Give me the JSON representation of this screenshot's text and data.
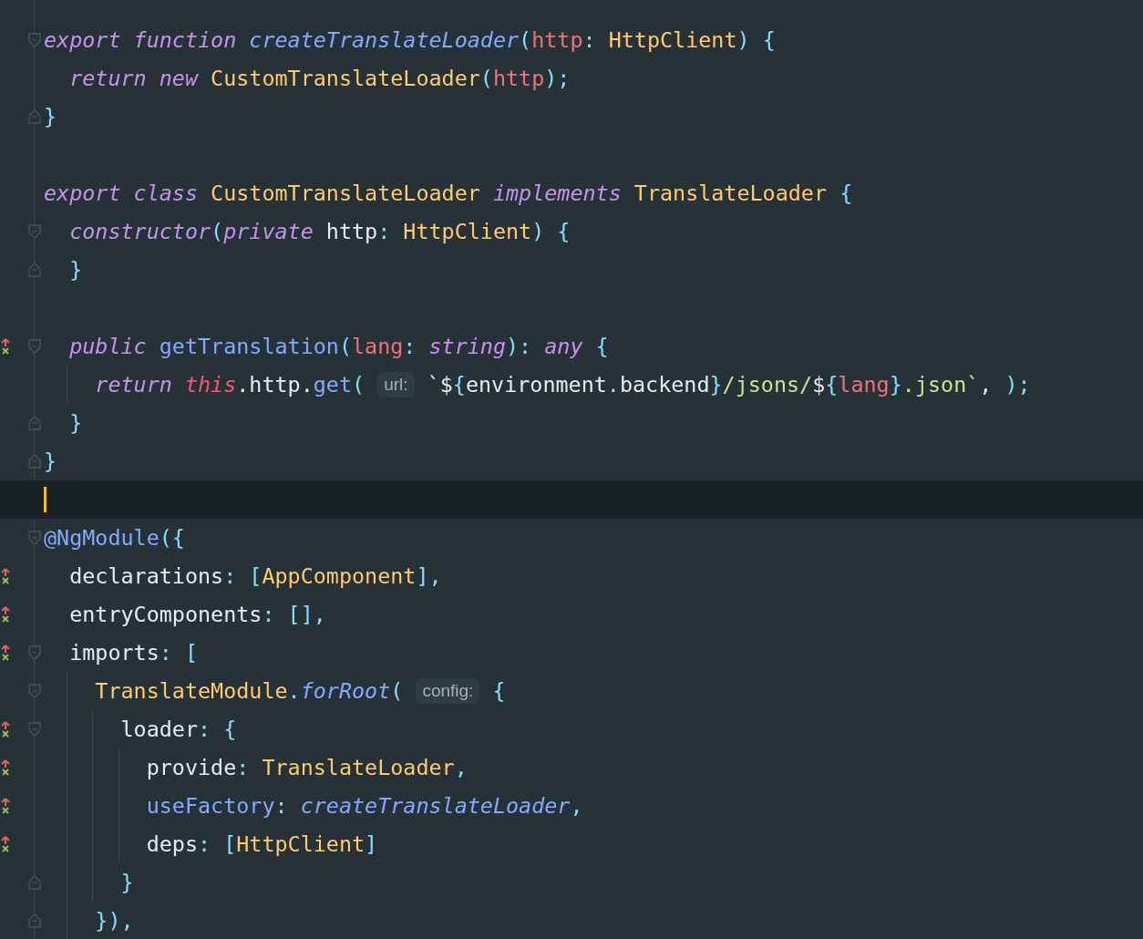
{
  "editor": {
    "lines": [
      {
        "fold_open": true,
        "fold_close": false,
        "marked": false,
        "current": false,
        "tokens": [
          {
            "kind": "kw",
            "text": "export "
          },
          {
            "kind": "kw",
            "text": "function "
          },
          {
            "kind": "fn_italic",
            "text": "createTranslateLoader"
          },
          {
            "kind": "punct",
            "text": "("
          },
          {
            "kind": "param",
            "text": "http"
          },
          {
            "kind": "punct",
            "text": ": "
          },
          {
            "kind": "type",
            "text": "HttpClient"
          },
          {
            "kind": "punct",
            "text": ") {"
          }
        ]
      },
      {
        "fold_open": false,
        "fold_close": false,
        "marked": false,
        "current": false,
        "tokens": [
          {
            "kind": "kw",
            "text": "  return "
          },
          {
            "kind": "kw",
            "text": "new "
          },
          {
            "kind": "type",
            "text": "CustomTranslateLoader"
          },
          {
            "kind": "punct",
            "text": "("
          },
          {
            "kind": "param",
            "text": "http"
          },
          {
            "kind": "punct",
            "text": ");"
          }
        ]
      },
      {
        "fold_open": false,
        "fold_close": true,
        "marked": false,
        "current": false,
        "tokens": [
          {
            "kind": "punct",
            "text": "}"
          }
        ]
      },
      {
        "fold_open": false,
        "fold_close": false,
        "marked": false,
        "current": false
      },
      {
        "fold_open": false,
        "fold_close": false,
        "marked": false,
        "current": false,
        "tokens": [
          {
            "kind": "kw",
            "text": "export "
          },
          {
            "kind": "kw",
            "text": "class "
          },
          {
            "kind": "type",
            "text": "CustomTranslateLoader "
          },
          {
            "kind": "kw",
            "text": "implements "
          },
          {
            "kind": "type",
            "text": "TranslateLoader "
          },
          {
            "kind": "punct",
            "text": "{"
          }
        ]
      },
      {
        "fold_open": true,
        "fold_close": false,
        "marked": false,
        "current": false,
        "tokens": [
          {
            "kind": "kw",
            "text": "  constructor"
          },
          {
            "kind": "punct",
            "text": "("
          },
          {
            "kind": "kw",
            "text": "private "
          },
          {
            "kind": "plain",
            "text": "http"
          },
          {
            "kind": "punct",
            "text": ": "
          },
          {
            "kind": "type",
            "text": "HttpClient"
          },
          {
            "kind": "punct",
            "text": ") {"
          }
        ]
      },
      {
        "fold_open": false,
        "fold_close": true,
        "marked": false,
        "current": false,
        "tokens": [
          {
            "kind": "punct",
            "text": "  }"
          }
        ]
      },
      {
        "fold_open": false,
        "fold_close": false,
        "marked": false,
        "current": false
      },
      {
        "fold_open": true,
        "fold_close": false,
        "marked": true,
        "current": false,
        "tokens": [
          {
            "kind": "kw",
            "text": "  public "
          },
          {
            "kind": "fn",
            "text": "getTranslation"
          },
          {
            "kind": "punct",
            "text": "("
          },
          {
            "kind": "param",
            "text": "lang"
          },
          {
            "kind": "punct",
            "text": ": "
          },
          {
            "kind": "kw",
            "text": "string"
          },
          {
            "kind": "punct",
            "text": "): "
          },
          {
            "kind": "kw",
            "text": "any "
          },
          {
            "kind": "punct",
            "text": "{"
          }
        ]
      },
      {
        "fold_open": false,
        "fold_close": false,
        "marked": false,
        "current": false,
        "tokens": [
          {
            "kind": "kw",
            "text": "    return "
          },
          {
            "kind": "this",
            "text": "this"
          },
          {
            "kind": "plain",
            "text": ".http."
          },
          {
            "kind": "fn",
            "text": "get"
          },
          {
            "kind": "punct",
            "text": "( "
          },
          {
            "kind": "hint",
            "text": "url:"
          },
          {
            "kind": "plain",
            "text": " `$"
          },
          {
            "kind": "punct",
            "text": "{"
          },
          {
            "kind": "plain",
            "text": "environment"
          },
          {
            "kind": "punct",
            "text": "."
          },
          {
            "kind": "plain",
            "text": "backend"
          },
          {
            "kind": "punct",
            "text": "}"
          },
          {
            "kind": "str",
            "text": "/jsons/"
          },
          {
            "kind": "plain",
            "text": "$"
          },
          {
            "kind": "punct",
            "text": "{"
          },
          {
            "kind": "param",
            "text": "lang"
          },
          {
            "kind": "punct",
            "text": "}"
          },
          {
            "kind": "str",
            "text": ".json`"
          },
          {
            "kind": "plain",
            "text": ", "
          },
          {
            "kind": "punct",
            "text": ");"
          }
        ]
      },
      {
        "fold_open": false,
        "fold_close": true,
        "marked": false,
        "current": false,
        "tokens": [
          {
            "kind": "punct",
            "text": "  }"
          }
        ]
      },
      {
        "fold_open": false,
        "fold_close": true,
        "marked": false,
        "current": false,
        "tokens": [
          {
            "kind": "punct",
            "text": "}"
          }
        ]
      },
      {
        "fold_open": false,
        "fold_close": false,
        "marked": false,
        "current": true
      },
      {
        "fold_open": true,
        "fold_close": false,
        "marked": false,
        "current": false,
        "tokens": [
          {
            "kind": "deco",
            "text": "@NgModule"
          },
          {
            "kind": "punct",
            "text": "({"
          }
        ]
      },
      {
        "fold_open": false,
        "fold_close": false,
        "marked": true,
        "current": false,
        "tokens": [
          {
            "kind": "plain",
            "text": "  declarations"
          },
          {
            "kind": "punct",
            "text": ": ["
          },
          {
            "kind": "type",
            "text": "AppComponent"
          },
          {
            "kind": "punct",
            "text": "],"
          }
        ]
      },
      {
        "fold_open": false,
        "fold_close": false,
        "marked": true,
        "current": false,
        "tokens": [
          {
            "kind": "plain",
            "text": "  entryComponents"
          },
          {
            "kind": "punct",
            "text": ": [],"
          }
        ]
      },
      {
        "fold_open": true,
        "fold_close": false,
        "marked": true,
        "current": false,
        "tokens": [
          {
            "kind": "plain",
            "text": "  imports"
          },
          {
            "kind": "punct",
            "text": ": ["
          }
        ]
      },
      {
        "fold_open": true,
        "fold_close": false,
        "marked": false,
        "current": false,
        "tokens": [
          {
            "kind": "type",
            "text": "    TranslateModule"
          },
          {
            "kind": "punct",
            "text": "."
          },
          {
            "kind": "fn_italic",
            "text": "forRoot"
          },
          {
            "kind": "punct",
            "text": "( "
          },
          {
            "kind": "hint",
            "text": "config:"
          },
          {
            "kind": "punct",
            "text": " {"
          }
        ]
      },
      {
        "fold_open": true,
        "fold_close": false,
        "marked": true,
        "current": false,
        "tokens": [
          {
            "kind": "plain",
            "text": "      loader"
          },
          {
            "kind": "punct",
            "text": ": {"
          }
        ]
      },
      {
        "fold_open": false,
        "fold_close": false,
        "marked": true,
        "current": false,
        "tokens": [
          {
            "kind": "plain",
            "text": "        provide"
          },
          {
            "kind": "punct",
            "text": ": "
          },
          {
            "kind": "type",
            "text": "TranslateLoader"
          },
          {
            "kind": "punct",
            "text": ","
          }
        ]
      },
      {
        "fold_open": false,
        "fold_close": false,
        "marked": true,
        "current": false,
        "tokens": [
          {
            "kind": "fn",
            "text": "        useFactory"
          },
          {
            "kind": "punct",
            "text": ": "
          },
          {
            "kind": "fn_italic",
            "text": "createTranslateLoader"
          },
          {
            "kind": "punct",
            "text": ","
          }
        ]
      },
      {
        "fold_open": false,
        "fold_close": false,
        "marked": true,
        "current": false,
        "tokens": [
          {
            "kind": "plain",
            "text": "        deps"
          },
          {
            "kind": "punct",
            "text": ": ["
          },
          {
            "kind": "type",
            "text": "HttpClient"
          },
          {
            "kind": "punct",
            "text": "]"
          }
        ]
      },
      {
        "fold_open": false,
        "fold_close": true,
        "marked": false,
        "current": false,
        "tokens": [
          {
            "kind": "punct",
            "text": "      }"
          }
        ]
      },
      {
        "fold_open": false,
        "fold_close": true,
        "marked": false,
        "current": false,
        "tokens": [
          {
            "kind": "punct",
            "text": "    }),"
          }
        ]
      }
    ]
  }
}
